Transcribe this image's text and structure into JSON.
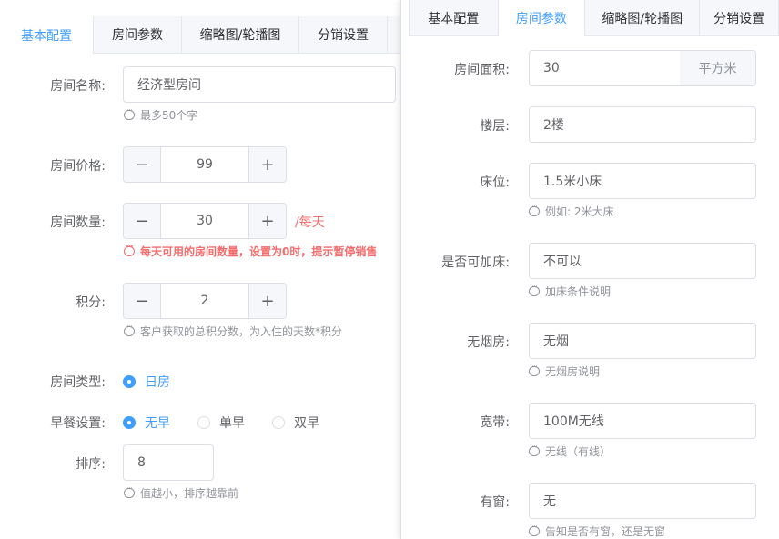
{
  "left": {
    "tabs": [
      "基本配置",
      "房间参数",
      "缩略图/轮播图",
      "分销设置"
    ],
    "room_name": {
      "label": "房间名称:",
      "value": "经济型房间",
      "hint": "最多50个字"
    },
    "room_price": {
      "label": "房间价格:",
      "value": "99"
    },
    "room_count": {
      "label": "房间数量:",
      "value": "30",
      "suffix": "/每天",
      "hint": "每天可用的房间数量，设置为0时，提示暂停销售"
    },
    "points": {
      "label": "积分:",
      "value": "2",
      "hint": "客户获取的总积分数，为入住的天数*积分"
    },
    "room_type": {
      "label": "房间类型:",
      "options": [
        "日房"
      ],
      "selected": 0
    },
    "breakfast": {
      "label": "早餐设置:",
      "options": [
        "无早",
        "单早",
        "双早"
      ],
      "selected": 0
    },
    "sort": {
      "label": "排序:",
      "value": "8",
      "hint": "值越小，排序越靠前"
    },
    "stepper_minus": "−",
    "stepper_plus": "+"
  },
  "right": {
    "tabs": [
      "基本配置",
      "房间参数",
      "缩略图/轮播图",
      "分销设置"
    ],
    "area": {
      "label": "房间面积:",
      "value": "30",
      "unit": "平方米"
    },
    "floor": {
      "label": "楼层:",
      "value": "2楼"
    },
    "bed": {
      "label": "床位:",
      "value": "1.5米小床",
      "hint": "例如: 2米大床"
    },
    "extra_bed": {
      "label": "是否可加床:",
      "value": "不可以",
      "hint": "加床条件说明"
    },
    "no_smoking": {
      "label": "无烟房:",
      "value": "无烟",
      "hint": "无烟房说明"
    },
    "broadband": {
      "label": "宽带:",
      "value": "100M无线",
      "hint": "无线（有线）"
    },
    "window": {
      "label": "有窗:",
      "value": "无",
      "hint": "告知是否有窗，还是无窗"
    }
  },
  "colors": {
    "primary": "#409eff",
    "danger": "#f56c6c",
    "border": "#dcdfe6"
  }
}
